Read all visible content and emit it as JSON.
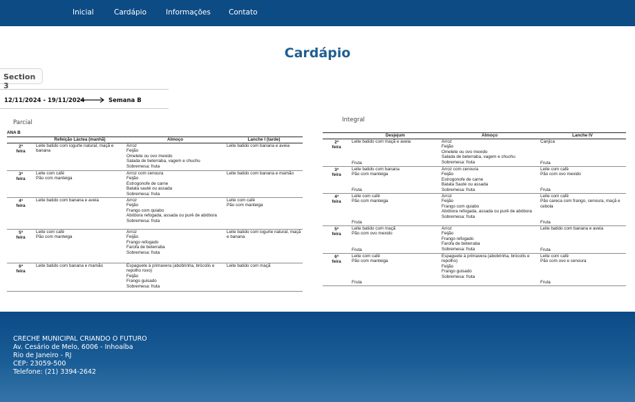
{
  "nav": {
    "items": [
      {
        "label": "Inicial"
      },
      {
        "label": "Cardápio"
      },
      {
        "label": "Informações"
      },
      {
        "label": "Contato"
      }
    ]
  },
  "page": {
    "title": "Cardápio",
    "section_label": "Section 3",
    "week_range": "12/11/2024 - 19/11/2024",
    "week_name": "Semana B"
  },
  "partial": {
    "label": "Parcial",
    "table_title": "ANA B",
    "headers": [
      "",
      "Refeição Láctea (manhã)",
      "Almoço",
      "Lanche I (tarde)"
    ],
    "rows": [
      {
        "day": [
          "2ª",
          "feira"
        ],
        "lactea": [
          "Leite batido com iogurte natural, maçã e banana"
        ],
        "almoco": [
          "Arroz",
          "Feijão",
          "Omelete ou ovo mexido",
          "Salada de beterraba, vagem e chuchu",
          "Sobremesa: fruta"
        ],
        "lanche": [
          "Leite batido com banana e aveia"
        ]
      },
      {
        "day": [
          "3ª",
          "feira"
        ],
        "lactea": [
          "Leite com café",
          "Pão com manteiga"
        ],
        "almoco": [
          "Arroz com cenoura",
          "Feijão",
          "Estrogonofe de carne",
          "Batata sauté ou assada",
          "Sobremesa: fruta"
        ],
        "lanche": [
          "Leite batido com banana e mamão"
        ]
      },
      {
        "day": [
          "4ª",
          "feira"
        ],
        "lactea": [
          "Leite batido com banana e aveia"
        ],
        "almoco": [
          "Arroz",
          "Feijão",
          "Frango com quiabo",
          "Abóbora refogada, assada ou purê de abóbora",
          "Sobremesa: fruta"
        ],
        "lanche": [
          "Leite com café",
          "Pão com manteiga"
        ]
      },
      {
        "day": [
          "5ª",
          "feira"
        ],
        "lactea": [
          "Leite com café",
          "Pão com manteiga"
        ],
        "almoco": [
          "Arroz",
          "Feijão",
          "Frango refogado",
          "Farofa de beterraba",
          "Sobremesa: fruta"
        ],
        "lanche": [
          "Leite batido com iogurte natural, maçã e banana"
        ]
      },
      {
        "day": [
          "6ª",
          "feira"
        ],
        "lactea": [
          "Leite batido com banana e mamão"
        ],
        "almoco": [
          "Espaguete à primavera (abobrinha, brócolis e repolho roxo)",
          "Feijão",
          "Frango guisado",
          "Sobremesa: fruta"
        ],
        "lanche": [
          "Leite batido com maçã"
        ]
      }
    ]
  },
  "integral": {
    "label": "Integral",
    "headers": [
      "",
      "Desjejum",
      "Almoço",
      "Lanche IV"
    ],
    "rows": [
      {
        "day": [
          "2ª",
          "feira"
        ],
        "desjejum": [
          "Leite batido com maçã e aveia"
        ],
        "desjejum_fruit": "Fruta",
        "almoco": [
          "Arroz",
          "Feijão",
          "Omelete ou ovo mexido",
          "Salada de beterraba, vagem e chuchu",
          "Sobremesa: fruta"
        ],
        "lanche": [
          "Canjica"
        ],
        "lanche_fruit": "Fruta"
      },
      {
        "day": [
          "3ª",
          "feira"
        ],
        "desjejum": [
          "Leite batido com banana",
          "Pão com manteiga"
        ],
        "desjejum_fruit": "Fruta",
        "almoco": [
          "Arroz com cenoura",
          "Feijão",
          "Estrogonofe de carne",
          "Batata Sauté ou assada",
          "Sobremesa: fruta"
        ],
        "lanche": [
          "Leite com café",
          "Pão com ovo mexido"
        ],
        "lanche_fruit": "Fruta"
      },
      {
        "day": [
          "4ª",
          "feira"
        ],
        "desjejum": [
          "Leite com café",
          "Pão com manteiga"
        ],
        "desjejum_fruit": "Fruta",
        "almoco": [
          "Arroz",
          "Feijão",
          "Frango com quiabo",
          "Abóbora refogada, assada ou purê de abóbora",
          "Sobremesa: fruta"
        ],
        "lanche": [
          "Leite com café",
          "Pão careca com frango, cenoura, maçã e cebola"
        ],
        "lanche_fruit": "Fruta"
      },
      {
        "day": [
          "5ª",
          "feira"
        ],
        "desjejum": [
          "Leite batido com maçã",
          "Pão com ovo mexido"
        ],
        "desjejum_fruit": "Fruta",
        "almoco": [
          "Arroz",
          "Feijão",
          "Frango refogado",
          "Farofa de beterraba",
          "Sobremesa: fruta"
        ],
        "lanche": [
          "Leite batido com banana e aveia"
        ],
        "lanche_fruit": "Fruta"
      },
      {
        "day": [
          "6ª",
          "feira"
        ],
        "desjejum": [
          "Leite com café",
          "Pão com manteiga"
        ],
        "desjejum_fruit": "Fruta",
        "almoco": [
          "Espaguete à primavera (abobrinha, brócolis e repolho)",
          "Feijão",
          "Frango guisado",
          "Sobremesa: fruta"
        ],
        "lanche": [
          "Leite com café",
          "Pão com ovo e cenoura"
        ],
        "lanche_fruit": "Fruta"
      }
    ]
  },
  "footer": {
    "lines": [
      "CRECHE MUNICIPAL CRIANDO O FUTURO",
      "Av. Cesário de Melo, 6006 - Inhoaíba",
      "Rio de Janeiro - RJ",
      "CEP: 23059-500",
      "Telefone: (21) 3394-2642"
    ]
  },
  "colors": {
    "nav_bg": "#0d4b85",
    "title": "#1f5f93",
    "footer_bg": "#0c4a86"
  }
}
